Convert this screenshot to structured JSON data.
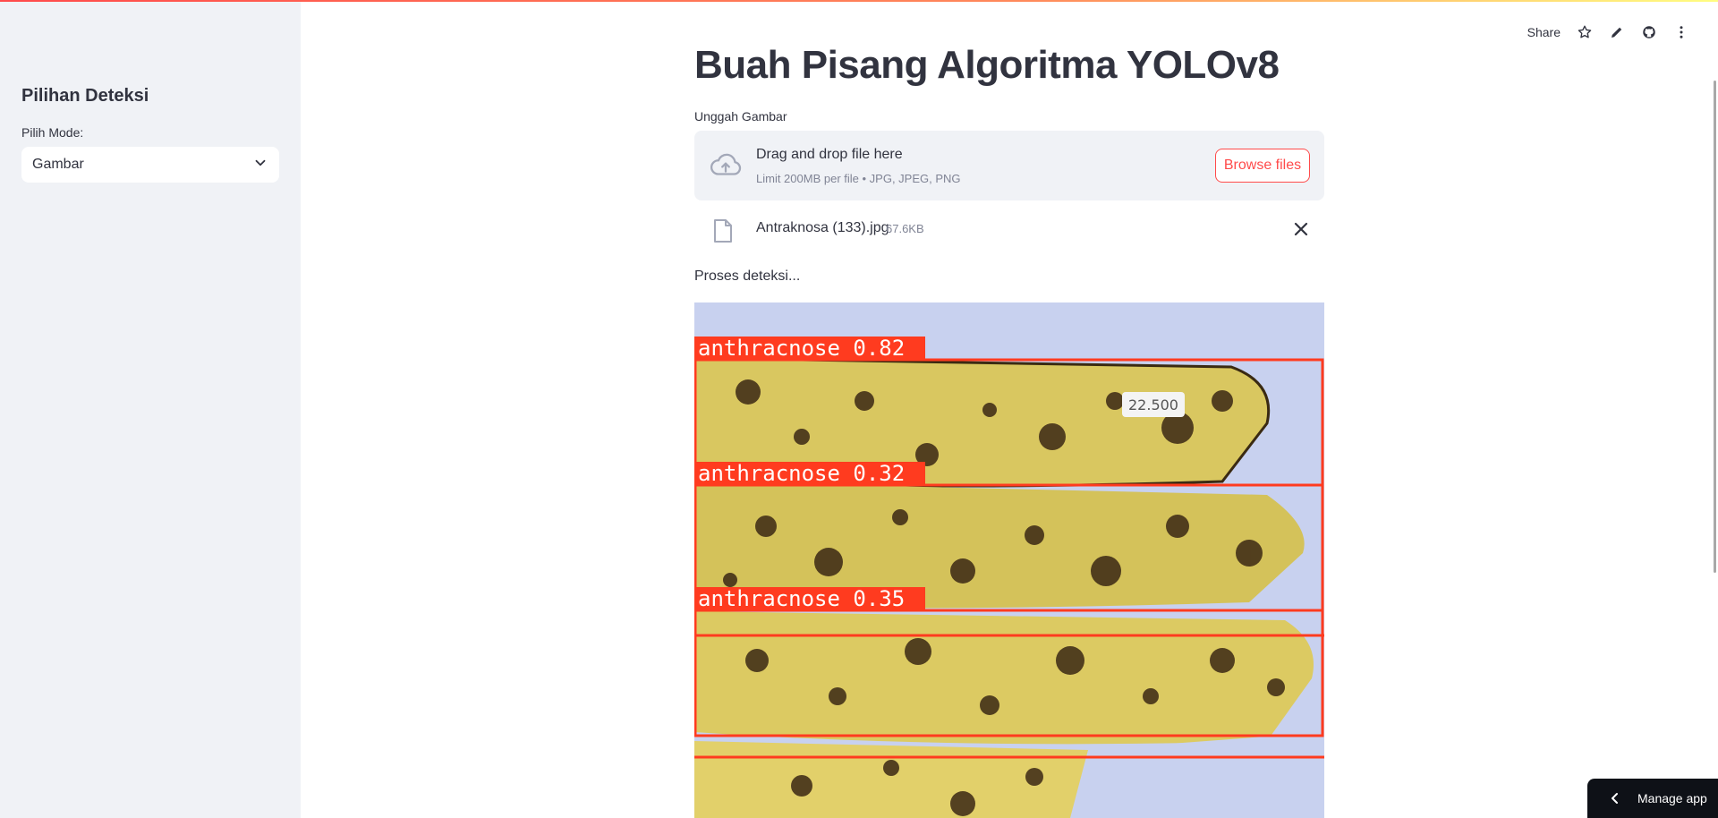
{
  "sidebar": {
    "title": "Pilihan Deteksi",
    "mode_label": "Pilih Mode:",
    "mode_selected": "Gambar"
  },
  "header": {
    "share_label": "Share",
    "icons": [
      "star-icon",
      "pencil-icon",
      "github-icon",
      "more-vertical-icon"
    ]
  },
  "main": {
    "title": "Buah Pisang Algoritma YOLOv8",
    "uploader": {
      "label": "Unggah Gambar",
      "drop_text": "Drag and drop file here",
      "limit_text": "Limit 200MB per file • JPG, JPEG, PNG",
      "browse_label": "Browse files"
    },
    "uploaded_file": {
      "name": "Antraknosa (133).jpg",
      "size": "67.6KB"
    },
    "status": "Proses deteksi...",
    "detections": [
      {
        "label": "anthracnose 0.82"
      },
      {
        "label": "anthracnose 0.32"
      },
      {
        "label": "anthracnose 0.35"
      }
    ],
    "price_tag": "22.500"
  },
  "footer": {
    "manage_app_label": "Manage app"
  },
  "colors": {
    "accent": "#ff4b4b",
    "sidebar_bg": "#f0f2f6",
    "detection_box": "#ff3b1f",
    "dark_button": "#0e1117"
  }
}
